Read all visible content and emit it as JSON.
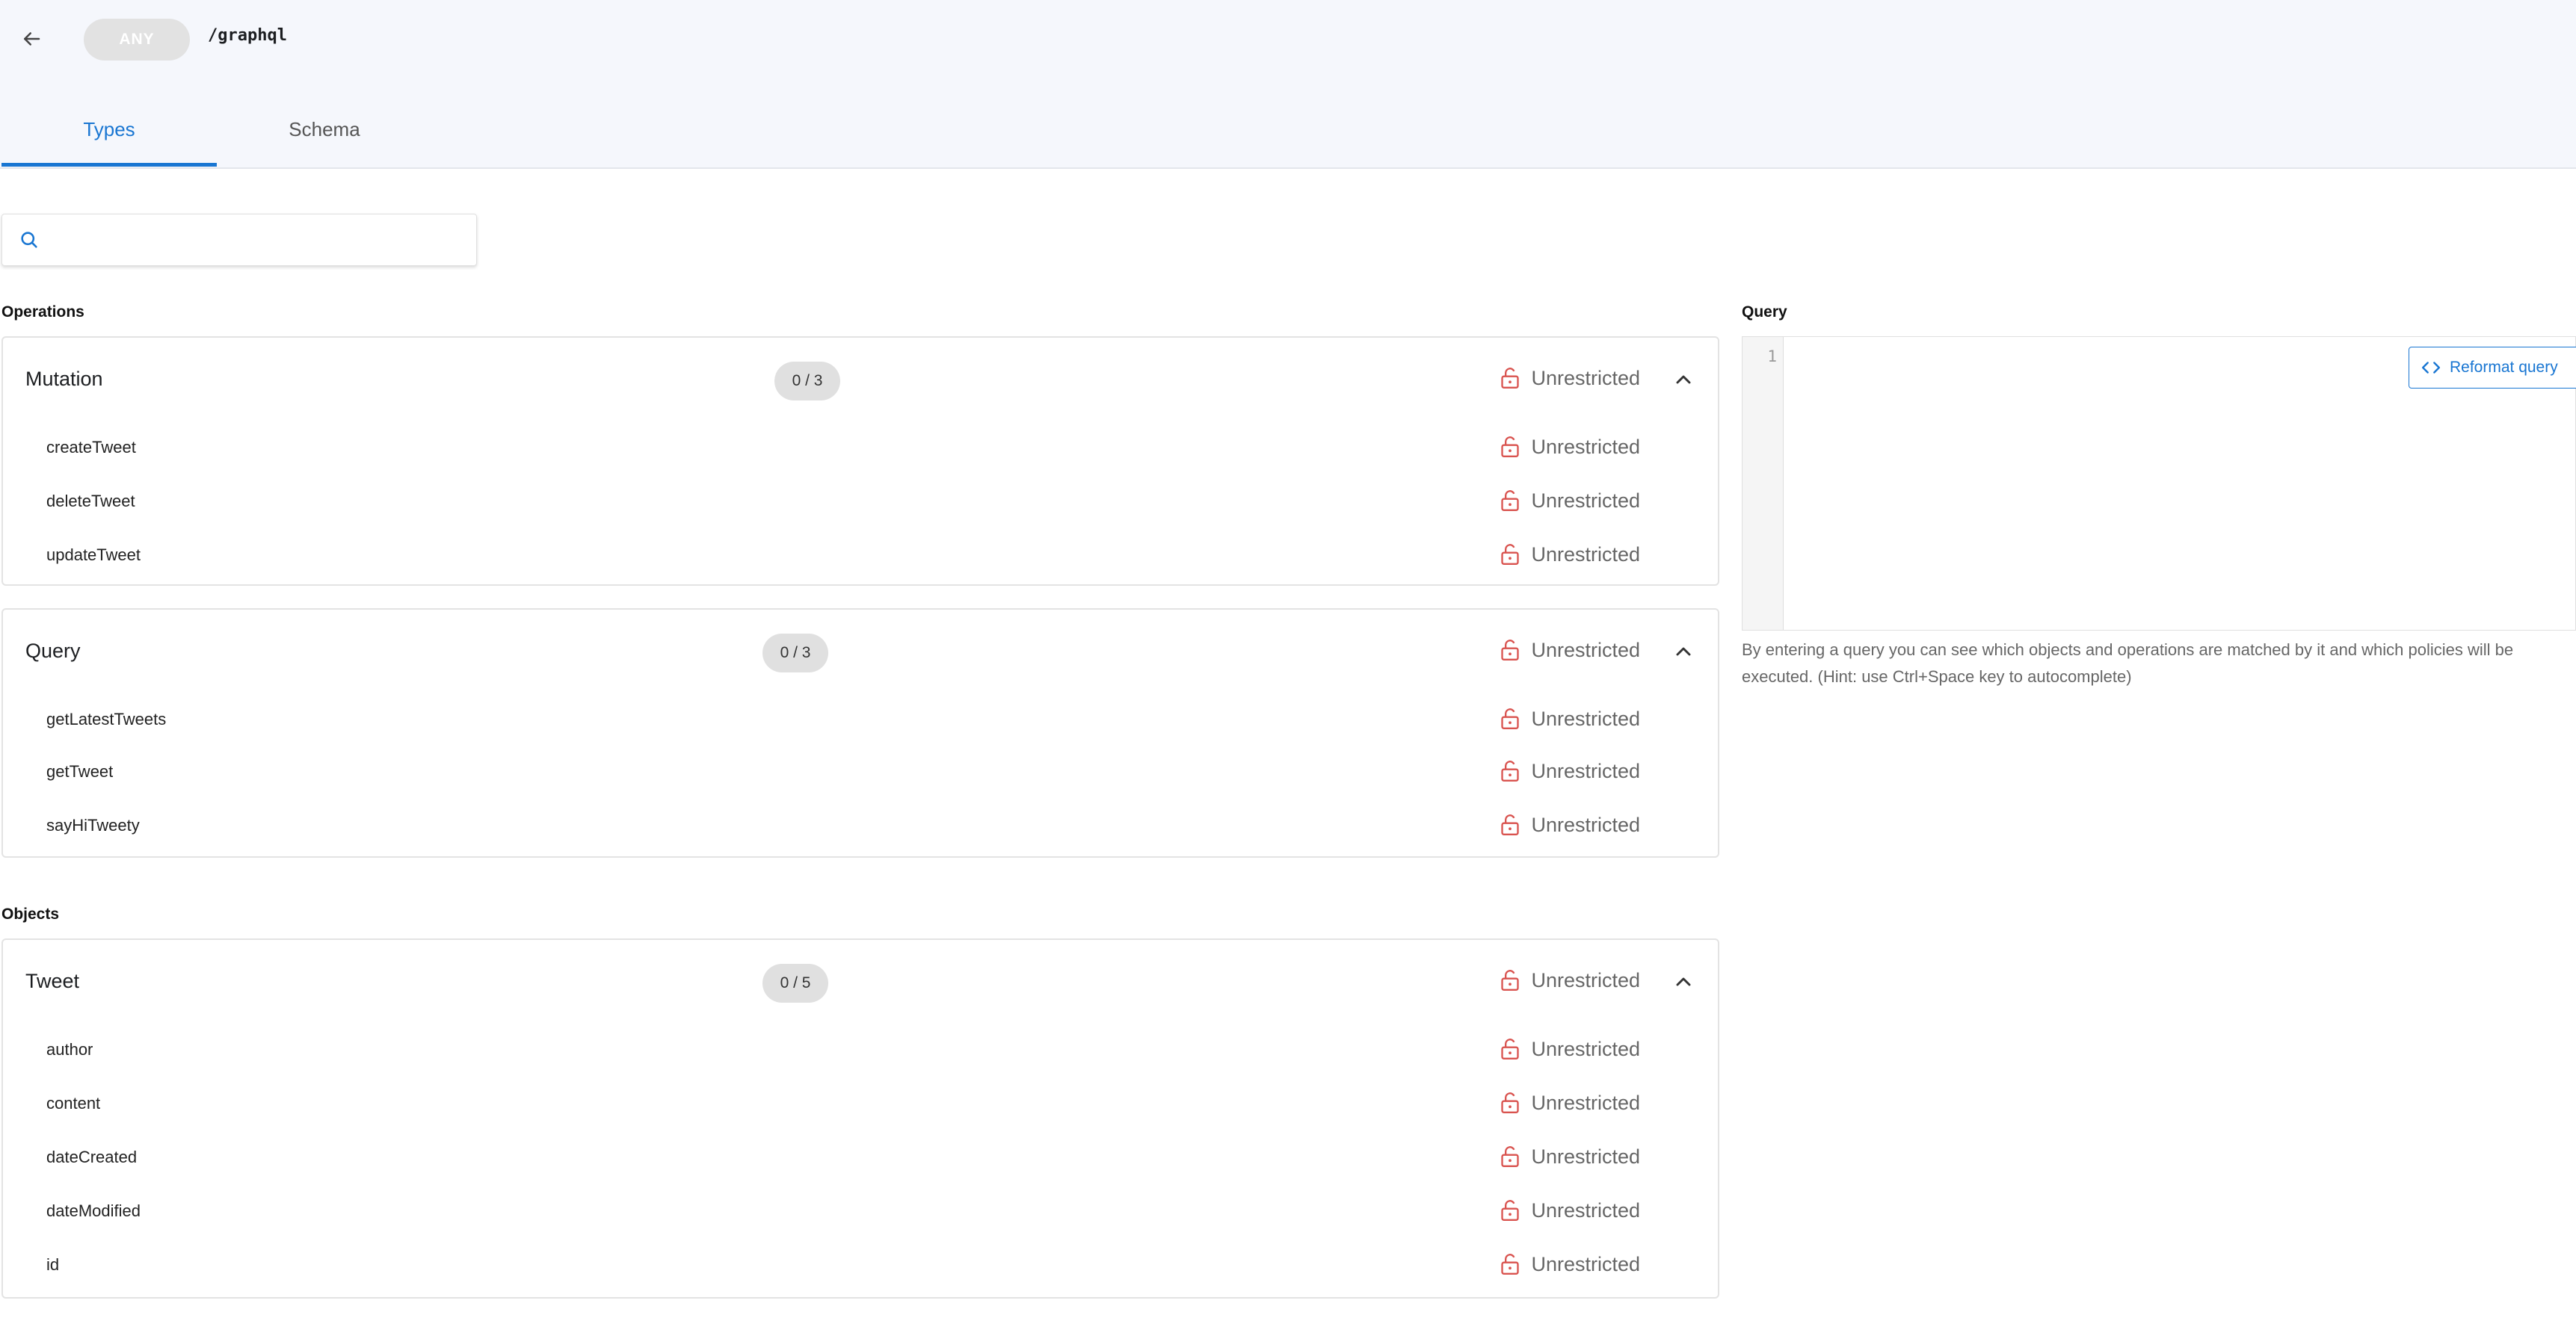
{
  "header": {
    "method": "ANY",
    "path": "/graphql"
  },
  "tabs": [
    {
      "label": "Types"
    },
    {
      "label": "Schema"
    }
  ],
  "search": {
    "value": "",
    "placeholder": ""
  },
  "sections": {
    "operations": "Operations",
    "objects": "Objects"
  },
  "mutation": {
    "title": "Mutation",
    "count": "0 / 3",
    "status": "Unrestricted",
    "rows": [
      {
        "label": "createTweet",
        "status": "Unrestricted"
      },
      {
        "label": "deleteTweet",
        "status": "Unrestricted"
      },
      {
        "label": "updateTweet",
        "status": "Unrestricted"
      }
    ]
  },
  "query": {
    "title": "Query",
    "count": "0 / 3",
    "status": "Unrestricted",
    "rows": [
      {
        "label": "getLatestTweets",
        "status": "Unrestricted"
      },
      {
        "label": "getTweet",
        "status": "Unrestricted"
      },
      {
        "label": "sayHiTweety",
        "status": "Unrestricted"
      }
    ]
  },
  "tweet": {
    "title": "Tweet",
    "count": "0 / 5",
    "status": "Unrestricted",
    "rows": [
      {
        "label": "author",
        "status": "Unrestricted"
      },
      {
        "label": "content",
        "status": "Unrestricted"
      },
      {
        "label": "dateCreated",
        "status": "Unrestricted"
      },
      {
        "label": "dateModified",
        "status": "Unrestricted"
      },
      {
        "label": "id",
        "status": "Unrestricted"
      }
    ]
  },
  "editor": {
    "title": "Query",
    "line_number": "1",
    "reformat_label": "Reformat query",
    "hint": "By entering a query you can see which objects and operations are matched by it and which policies will be executed. (Hint: use Ctrl+Space key to autocomplete)"
  },
  "colors": {
    "accent": "#1976d2",
    "lock": "#d9534f",
    "header_bg": "#f5f7fc"
  },
  "icons": {
    "back": "arrow-left-icon",
    "search": "search-icon",
    "lock": "lock-open-icon",
    "chevron": "chevron-up-icon",
    "code": "code-icon"
  }
}
